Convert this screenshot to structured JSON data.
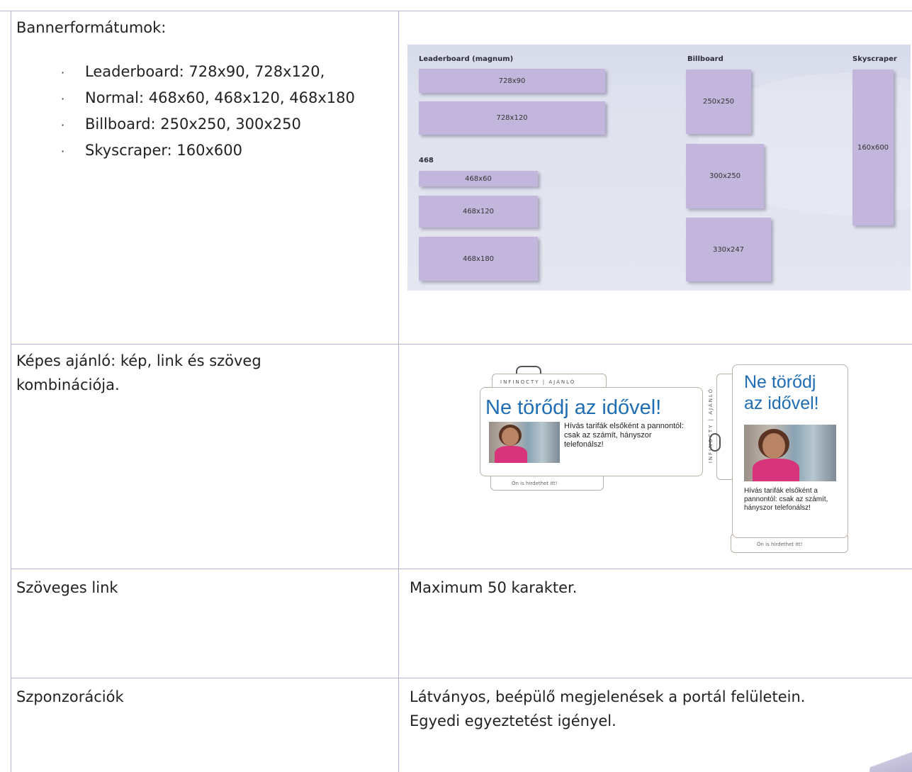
{
  "rows": [
    {
      "left_title": "Bannerformátumok:",
      "bullet_marker": "·",
      "bullets": [
        "Leaderboard: 728x90, 728x120,",
        "Normal: 468x60, 468x120, 468x180",
        "Billboard: 250x250, 300x250",
        "Skyscraper: 160x600"
      ]
    },
    {
      "left": "Képes ajánló: kép, link és szöveg kombinációja."
    },
    {
      "left": "Szöveges link",
      "right": "Maximum 50 karakter."
    },
    {
      "left": "Szponzorációk",
      "right_lines": [
        "Látványos, beépülő megjelenések a portál felületein.",
        "Egyedi egyeztetést igényel."
      ]
    }
  ],
  "banner_diagram": {
    "group_labels": {
      "leaderboard": "Leaderboard (magnum)",
      "billboard": "Billboard",
      "skyscraper": "Skyscraper",
      "normal": "468"
    },
    "sizes": [
      "728x90",
      "728x120",
      "468x60",
      "468x120",
      "468x180",
      "250x250",
      "300x250",
      "330x247",
      "160x600"
    ]
  },
  "recommender": {
    "logo": "INFINOCTY | AJÁNLÓ",
    "headline_wide": "Ne törődj az idővel!",
    "headline_tall": [
      "Ne törődj",
      "az idővel!"
    ],
    "body": "Hívás tarifák elsőként a pannontól: csak az számít, hányszor telefonálsz!",
    "footer": "Ön is hirdethet itt!"
  },
  "colors": {
    "grid": "#b7b3d6",
    "banner_box": "#c2b6dc",
    "headline": "#1f6db5"
  }
}
